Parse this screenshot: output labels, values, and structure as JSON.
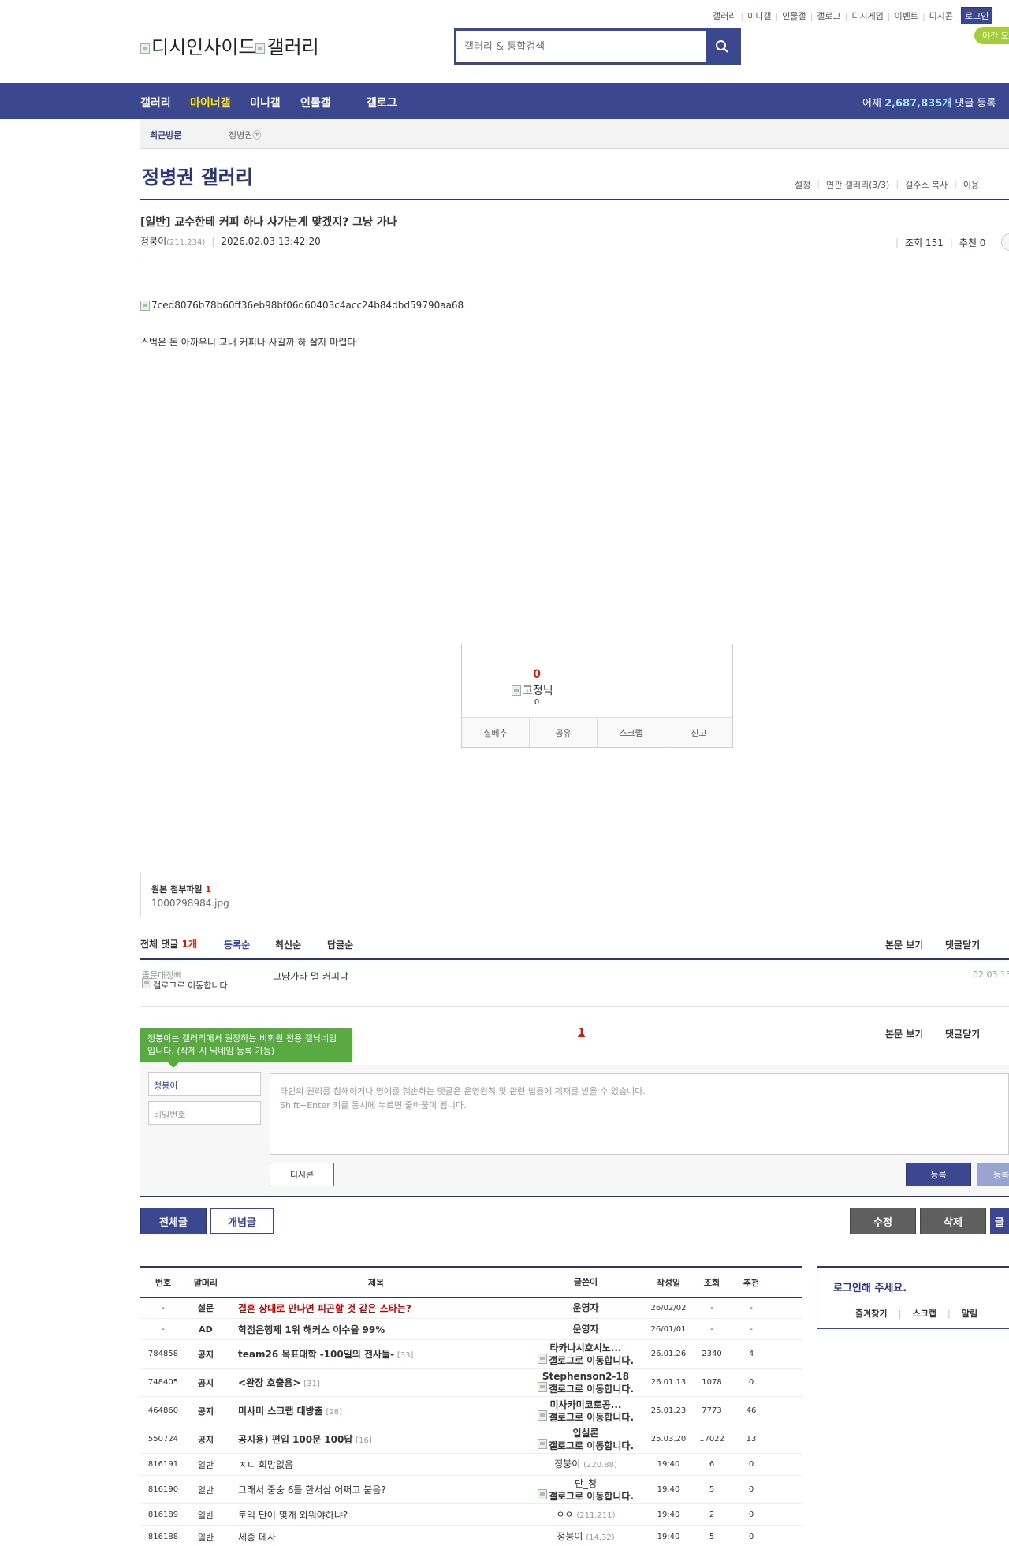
{
  "header": {
    "top_links": [
      "갤러리",
      "미니갤",
      "인물갤",
      "갤로그",
      "디시게임",
      "이벤트",
      "디시콘"
    ],
    "login": "로그인",
    "night": "야간 모",
    "logo_alt": "디시인사이드",
    "logo_alt2": "갤러리",
    "search_placeholder": "갤러리 & 통합검색"
  },
  "gnb": {
    "items": [
      "갤러리",
      "마이너갤",
      "미니갤",
      "인물갤",
      "갤로그"
    ],
    "yesterday_prefix": "어제",
    "yesterday_count": "2,687,835개",
    "yesterday_suffix": "댓글 등록"
  },
  "visit": {
    "label": "최근방문",
    "item": "정병권",
    "item_badge": "ⓜ"
  },
  "gallery": {
    "title": "정병권 갤러리",
    "menu": [
      "설정",
      "연관 갤러리(3/3)",
      "갤주소 복사",
      "이용"
    ]
  },
  "post": {
    "title": "[일반] 교수한테 커피 하나 사가는게 맞겠지? 그냥 가나",
    "author": "정붕이",
    "ip": "(211.234)",
    "date": "2026.02.03 13:42:20",
    "views": "조회 151",
    "recommend": "추천 0",
    "image_alt": "7ced8076b78b60ff36eb98bf06d60403c4acc24b84dbd59790aa68",
    "body": "스벅은 돈 아까우니 교내 커피나 사갈까 하 살자 마렵다"
  },
  "recommend_box": {
    "count": "0",
    "label": "고정닉",
    "sub": "0",
    "buttons": [
      "실베추",
      "공유",
      "스크랩",
      "신고"
    ]
  },
  "attach": {
    "title": "원본 첨부파일",
    "count": "1",
    "file": "1000298984.jpg"
  },
  "comments": {
    "total_label": "전체 댓글",
    "total_count": "1개",
    "sorts": [
      "등록순",
      "최신순",
      "답글순"
    ],
    "right_links": [
      "본문 보기",
      "댓글닫기"
    ],
    "items": [
      {
        "name": "좋문대정삐",
        "gallog": "갤로그로 이동합니다.",
        "text": "그냥가라 멀 커피냐",
        "date": "02.03 13"
      }
    ],
    "page": "1"
  },
  "write": {
    "tooltip": "정붕이는 갤러리에서 권장하는 비회원 전용 갤닉네임입니다. (삭제 시 닉네임 등록 가능)",
    "name": "정붕이",
    "password_placeholder": "비밀번호",
    "textarea_line1": "타인의 권리를 침해하거나 명예를 훼손하는 댓글은 운영원칙 및 관련 법률에 제재를 받을 수 있습니다.",
    "textarea_line2": "Shift+Enter 키를 동시에 누르면 줄바꿈이 됩니다.",
    "dccon": "디시콘",
    "submit": "등록",
    "submit2": "등록"
  },
  "board_buttons": {
    "all": "전체글",
    "concept": "개념글",
    "edit": "수정",
    "delete": "삭제",
    "write": "글"
  },
  "list": {
    "headers": [
      "번호",
      "말머리",
      "제목",
      "글쓴이",
      "작성일",
      "조회",
      "추천"
    ],
    "rows": [
      {
        "no": "-",
        "sub": "설문",
        "title": "결혼 상대로 만나면 피곤할 것 같은 스타는?",
        "reply": "",
        "writer": "운영자",
        "writer2": "",
        "ip": "",
        "date": "26/02/02",
        "views": "-",
        "rec": "-",
        "red": true,
        "bold": true
      },
      {
        "no": "-",
        "sub": "AD",
        "title": "학점은행제 1위 해커스 이수율 99%",
        "reply": "",
        "writer": "운영자",
        "writer2": "",
        "ip": "",
        "date": "26/01/01",
        "views": "-",
        "rec": "-",
        "red": false,
        "bold": true
      },
      {
        "no": "784858",
        "sub": "공지",
        "title": "team26 목표대학 -100일의 전사들-",
        "reply": "[33]",
        "writer": "타카나시호시노...",
        "writer2": "갤로그로 이동합니다.",
        "ip": "",
        "date": "26.01.26",
        "views": "2340",
        "rec": "4",
        "red": false,
        "bold": true
      },
      {
        "no": "748405",
        "sub": "공지",
        "title": "<완장 호출용>",
        "reply": "[31]",
        "writer": "Stephenson2-18",
        "writer2": "갤로그로 이동합니다.",
        "ip": "",
        "date": "26.01.13",
        "views": "1078",
        "rec": "0",
        "red": false,
        "bold": true
      },
      {
        "no": "464860",
        "sub": "공지",
        "title": "미사미 스크랩 대방출",
        "reply": "[28]",
        "writer": "미사카미코토공...",
        "writer2": "갤로그로 이동합니다.",
        "ip": "",
        "date": "25.01.23",
        "views": "7773",
        "rec": "46",
        "red": false,
        "bold": true
      },
      {
        "no": "550724",
        "sub": "공지",
        "title": "공지용) 편입 100문 100답",
        "reply": "[16]",
        "writer": "입실론",
        "writer2": "갤로그로 이동합니다.",
        "ip": "",
        "date": "25.03.20",
        "views": "17022",
        "rec": "13",
        "red": false,
        "bold": true
      },
      {
        "no": "816191",
        "sub": "일반",
        "title": "ㅈㄴ 희망없음",
        "reply": "",
        "writer": "정붕이",
        "writer2": "",
        "ip": "(220.88)",
        "date": "19:40",
        "views": "6",
        "rec": "0",
        "red": false,
        "bold": false
      },
      {
        "no": "816190",
        "sub": "일반",
        "title": "그래서 중숭 6틀 한서삼 어쩌고 붙음?",
        "reply": "",
        "writer": "단_청",
        "writer2": "갤로그로 이동합니다.",
        "ip": "",
        "date": "19:40",
        "views": "5",
        "rec": "0",
        "red": false,
        "bold": false
      },
      {
        "no": "816189",
        "sub": "일반",
        "title": "토익 단어 몇개 외워야하냐?",
        "reply": "",
        "writer": "ㅇㅇ",
        "writer2": "",
        "ip": "(211.211)",
        "date": "19:40",
        "views": "2",
        "rec": "0",
        "red": false,
        "bold": false
      },
      {
        "no": "816188",
        "sub": "일반",
        "title": "세종 데사",
        "reply": "",
        "writer": "정붕이",
        "writer2": "",
        "ip": "(14.32)",
        "date": "19:40",
        "views": "5",
        "rec": "0",
        "red": false,
        "bold": false
      }
    ]
  },
  "side": {
    "title": "로그인해 주세요.",
    "menu": [
      "즐겨찾기",
      "스크랩",
      "알림"
    ]
  },
  "colors": {
    "brand": "#3b4890",
    "brand_dark": "#29367c",
    "highlight": "#ffe400",
    "red": "#d31900",
    "green": "#5aaa42"
  }
}
